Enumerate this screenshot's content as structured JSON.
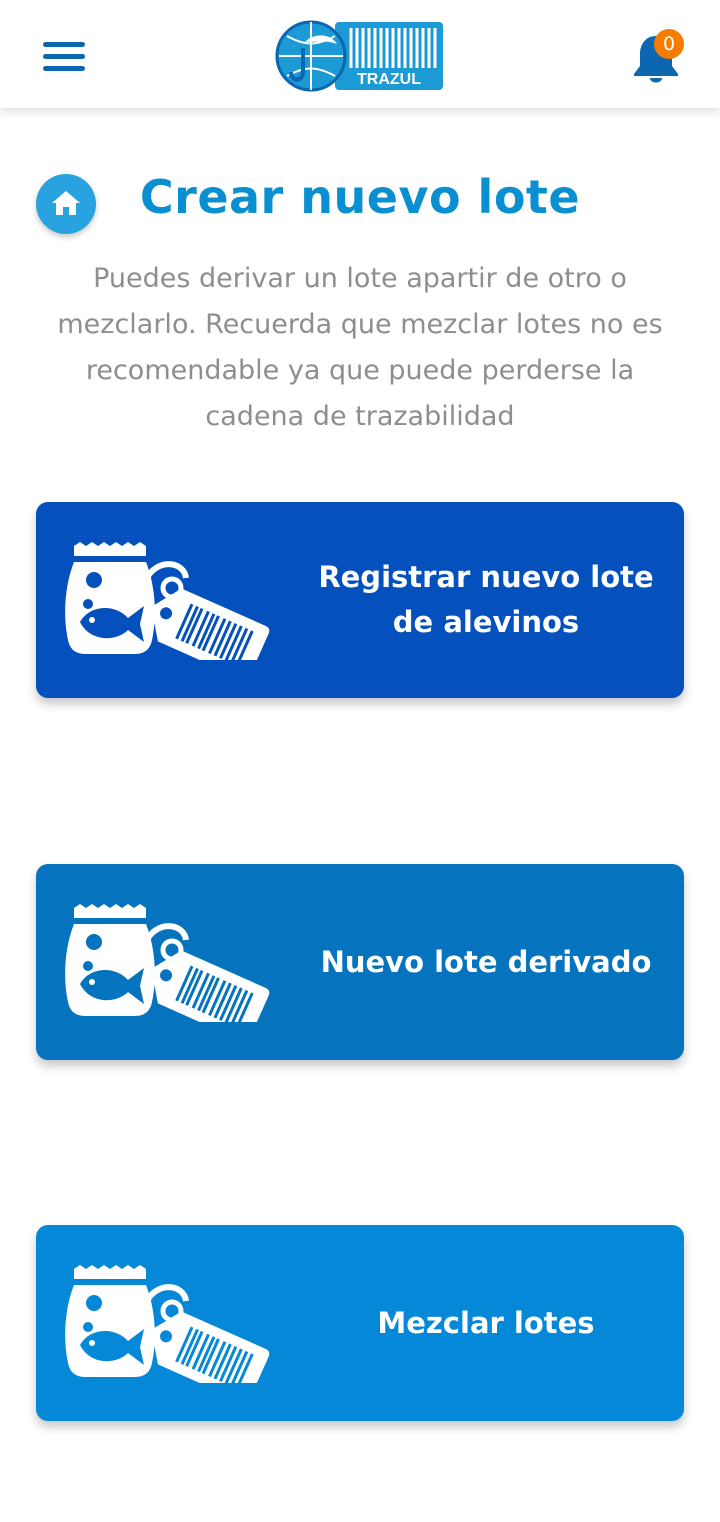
{
  "header": {
    "logo_text": "TRAZUL",
    "notification_count": "0"
  },
  "page": {
    "title": "Crear nuevo lote",
    "description": "Puedes derivar un lote apartir de otro o mezclarlo. Recuerda que mezclar lotes no es recomendable ya que puede perderse la cadena de trazabilidad"
  },
  "actions": [
    {
      "label": "Registrar nuevo lote de alevinos",
      "icon": "fish-bag-tag-icon",
      "color": "#0451bd"
    },
    {
      "label": "Nuevo lote derivado",
      "icon": "fish-bag-tag-icon",
      "color": "#0573bd"
    },
    {
      "label": "Mezclar lotes",
      "icon": "fish-bag-tag-icon",
      "color": "#0688d9"
    }
  ],
  "colors": {
    "primary": "#0a8fd1",
    "nav_icon": "#0a67b0",
    "badge": "#f57c00",
    "home_button": "#29a3e0"
  }
}
